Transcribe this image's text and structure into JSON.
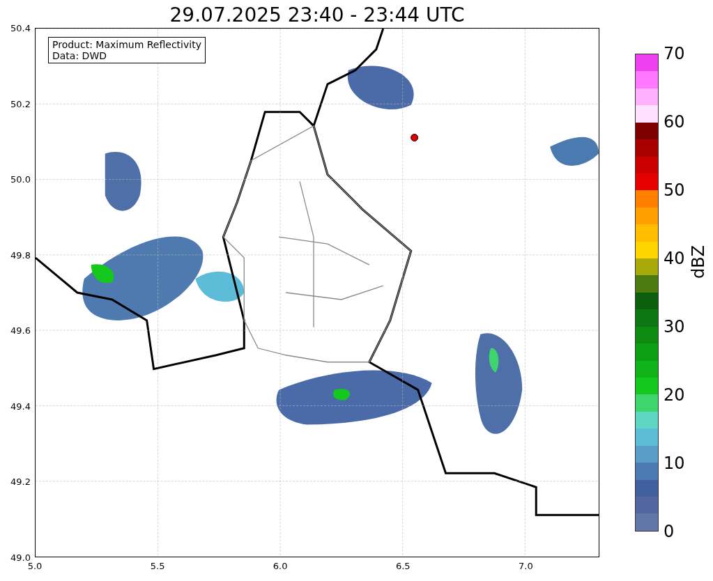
{
  "title": "29.07.2025 23:40 - 23:44 UTC",
  "legend": [
    "Product: Maximum Reflectivity",
    "Data: DWD"
  ],
  "yticks": [
    "50.4",
    "50.2",
    "50.0",
    "49.8",
    "49.6",
    "49.4",
    "49.2",
    "49.0"
  ],
  "xticks": [
    "5.0",
    "5.5",
    "6.0",
    "6.5",
    "7.0"
  ],
  "colorbar": {
    "label": "dBZ",
    "ticks": [
      "70",
      "60",
      "50",
      "40",
      "30",
      "20",
      "10",
      "0"
    ],
    "bands": [
      {
        "color": "#6376a8"
      },
      {
        "color": "#5266a0"
      },
      {
        "color": "#4160a0"
      },
      {
        "color": "#4a7ab0"
      },
      {
        "color": "#5a9ec8"
      },
      {
        "color": "#5cbcd8"
      },
      {
        "color": "#5ed6c4"
      },
      {
        "color": "#3ed46e"
      },
      {
        "color": "#14c81e"
      },
      {
        "color": "#10b41a"
      },
      {
        "color": "#0e9e14"
      },
      {
        "color": "#0e8a10"
      },
      {
        "color": "#0c7610"
      },
      {
        "color": "#0a5e0c"
      },
      {
        "color": "#4a7a10"
      },
      {
        "color": "#a8aa0c"
      },
      {
        "color": "#ffd400"
      },
      {
        "color": "#ffbe00"
      },
      {
        "color": "#ffa000"
      },
      {
        "color": "#ff8000"
      },
      {
        "color": "#e60000"
      },
      {
        "color": "#cc0000"
      },
      {
        "color": "#a80000"
      },
      {
        "color": "#7e0000"
      },
      {
        "color": "#ffe0ff"
      },
      {
        "color": "#ffb0ff"
      },
      {
        "color": "#ff78ff"
      },
      {
        "color": "#ee40ee"
      }
    ]
  }
}
